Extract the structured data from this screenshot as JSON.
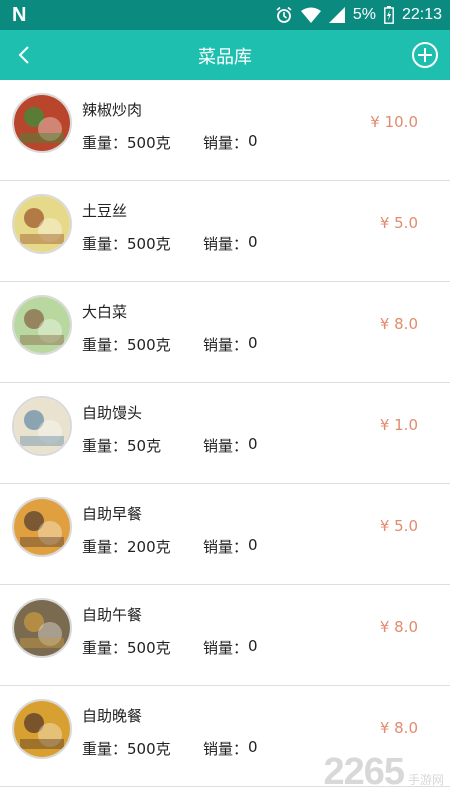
{
  "status_bar": {
    "logo": "N",
    "battery": "5%",
    "time": "22:13"
  },
  "header": {
    "title": "菜品库",
    "back_icon": "chevron-left-icon",
    "add_icon": "plus-circle-icon"
  },
  "labels": {
    "weight": "重量：",
    "sales": "销量："
  },
  "dishes": [
    {
      "name": "辣椒炒肉",
      "weight": "500克",
      "sales": "0",
      "price": "¥ 10.0",
      "thumb_color": "#b8452c",
      "thumb_accent": "#3c8f3a"
    },
    {
      "name": "土豆丝",
      "weight": "500克",
      "sales": "0",
      "price": "¥ 5.0",
      "thumb_color": "#e6d98a",
      "thumb_accent": "#a05a2c"
    },
    {
      "name": "大白菜",
      "weight": "500克",
      "sales": "0",
      "price": "¥ 8.0",
      "thumb_color": "#b8d8a0",
      "thumb_accent": "#8a6a48"
    },
    {
      "name": "自助馒头",
      "weight": "50克",
      "sales": "0",
      "price": "¥ 1.0",
      "thumb_color": "#e9e2cf",
      "thumb_accent": "#6b8fa8"
    },
    {
      "name": "自助早餐",
      "weight": "200克",
      "sales": "0",
      "price": "¥ 5.0",
      "thumb_color": "#e0a040",
      "thumb_accent": "#5a4030"
    },
    {
      "name": "自助午餐",
      "weight": "500克",
      "sales": "0",
      "price": "¥ 8.0",
      "thumb_color": "#7a6a50",
      "thumb_accent": "#c89a40"
    },
    {
      "name": "自助晚餐",
      "weight": "500克",
      "sales": "0",
      "price": "¥ 8.0",
      "thumb_color": "#d8a030",
      "thumb_accent": "#5a3a28"
    }
  ],
  "watermark": {
    "number": "2265",
    "text": "手游网"
  },
  "colors": {
    "status_bar": "#0b8a80",
    "header": "#1fbfb0",
    "price": "#e28b6e"
  }
}
